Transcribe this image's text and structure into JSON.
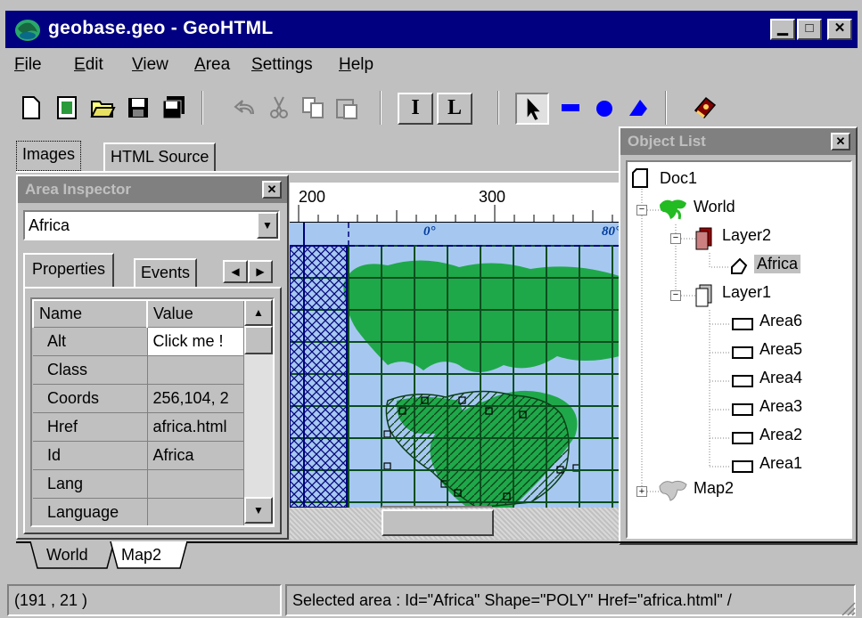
{
  "window": {
    "title": "geobase.geo - GeoHTML",
    "min_icon": "minimize-icon",
    "max_icon": "maximize-icon",
    "close_icon": "close-icon"
  },
  "menu": [
    {
      "key": "F",
      "rest": "ile"
    },
    {
      "key": "E",
      "rest": "dit"
    },
    {
      "key": "V",
      "rest": "iew"
    },
    {
      "key": "A",
      "rest": "rea"
    },
    {
      "key": "S",
      "rest": "ettings"
    },
    {
      "key": "H",
      "rest": "elp"
    }
  ],
  "toolbar": {
    "icons": [
      "new-icon",
      "image-icon",
      "open-icon",
      "save-icon",
      "save-all-icon",
      "undo-icon",
      "cut-icon",
      "copy-icon",
      "paste-icon",
      "text-i-icon",
      "text-l-icon",
      "pointer-icon",
      "rect-tool-icon",
      "circle-tool-icon",
      "poly-tool-icon",
      "help-book-icon"
    ],
    "text_i": "I",
    "text_l": "L"
  },
  "doc_tabs": {
    "images": "Images",
    "html_source": "HTML Source"
  },
  "inspector": {
    "title": "Area Inspector",
    "selected": "Africa",
    "tabs": {
      "properties": "Properties",
      "events": "Events"
    },
    "headers": {
      "name": "Name",
      "value": "Value"
    },
    "rows": [
      {
        "name": "Alt",
        "value": "Click me !"
      },
      {
        "name": "Class",
        "value": ""
      },
      {
        "name": "Coords",
        "value": "256,104, 2"
      },
      {
        "name": "Href",
        "value": "africa.html"
      },
      {
        "name": "Id",
        "value": "Africa"
      },
      {
        "name": "Lang",
        "value": ""
      },
      {
        "name": "Language",
        "value": ""
      }
    ]
  },
  "ruler": {
    "label_200": "200",
    "label_300": "300"
  },
  "map": {
    "label_0": "0°",
    "label_80": "80°"
  },
  "object_list": {
    "title": "Object List",
    "doc": "Doc1",
    "world": "World",
    "layer2": "Layer2",
    "africa": "Africa",
    "layer1": "Layer1",
    "areas": [
      "Area6",
      "Area5",
      "Area4",
      "Area3",
      "Area2",
      "Area1"
    ],
    "map2": "Map2"
  },
  "bottom_tabs": {
    "world": "World",
    "map2": "Map2"
  },
  "status": {
    "coords": "(191 , 21 )",
    "selection": "Selected area : Id=\"Africa\"  Shape=\"POLY\"  Href=\"africa.html\"  /"
  },
  "colors": {
    "title_bg": "#000080",
    "sea": "#a6c8f0",
    "land": "#1fa84a",
    "grid": "#0b4e1e",
    "hatch": "#00007a"
  }
}
